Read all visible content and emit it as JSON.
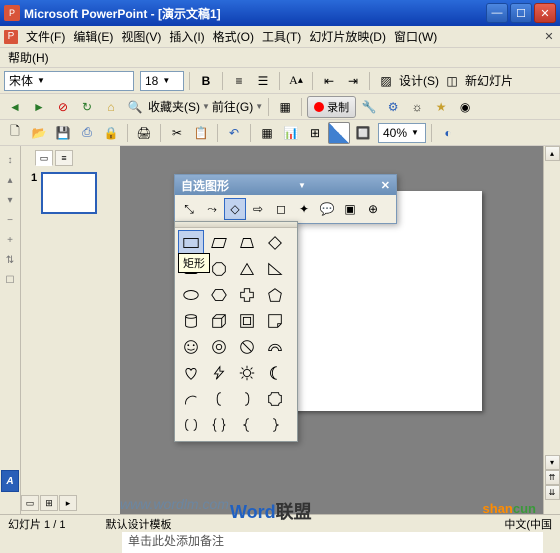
{
  "titlebar": {
    "app": "Microsoft PowerPoint",
    "sep": " - ",
    "doc": "[演示文稿1]"
  },
  "menus": {
    "file": "文件(F)",
    "edit": "编辑(E)",
    "view": "视图(V)",
    "insert": "插入(I)",
    "format": "格式(O)",
    "tools": "工具(T)",
    "slideshow": "幻灯片放映(D)",
    "window": "窗口(W)",
    "help": "帮助(H)"
  },
  "format_bar": {
    "font": "宋体",
    "size": "18"
  },
  "toolbar2": {
    "bold": "B",
    "design": "设计(S)",
    "newslide": "新幻灯片"
  },
  "toolbar3": {
    "favorites": "收藏夹(S)",
    "goto": "前往(G)",
    "record": "录制"
  },
  "toolbar4": {
    "zoom": "40%"
  },
  "thumbs": {
    "slide_num": "1"
  },
  "autoshapes": {
    "title": "自选图形",
    "tooltip": "矩形"
  },
  "notes": {
    "placeholder": "单击此处添加备注"
  },
  "status": {
    "slide": "幻灯片 1 / 1",
    "template": "默认设计模板",
    "lang": "中文(中国"
  },
  "watermark": {
    "url": "www.wordlm.com",
    "brand1a": "Word",
    "brand1b": "联盟",
    "brand2a": "shan",
    "brand2b": "cun"
  }
}
